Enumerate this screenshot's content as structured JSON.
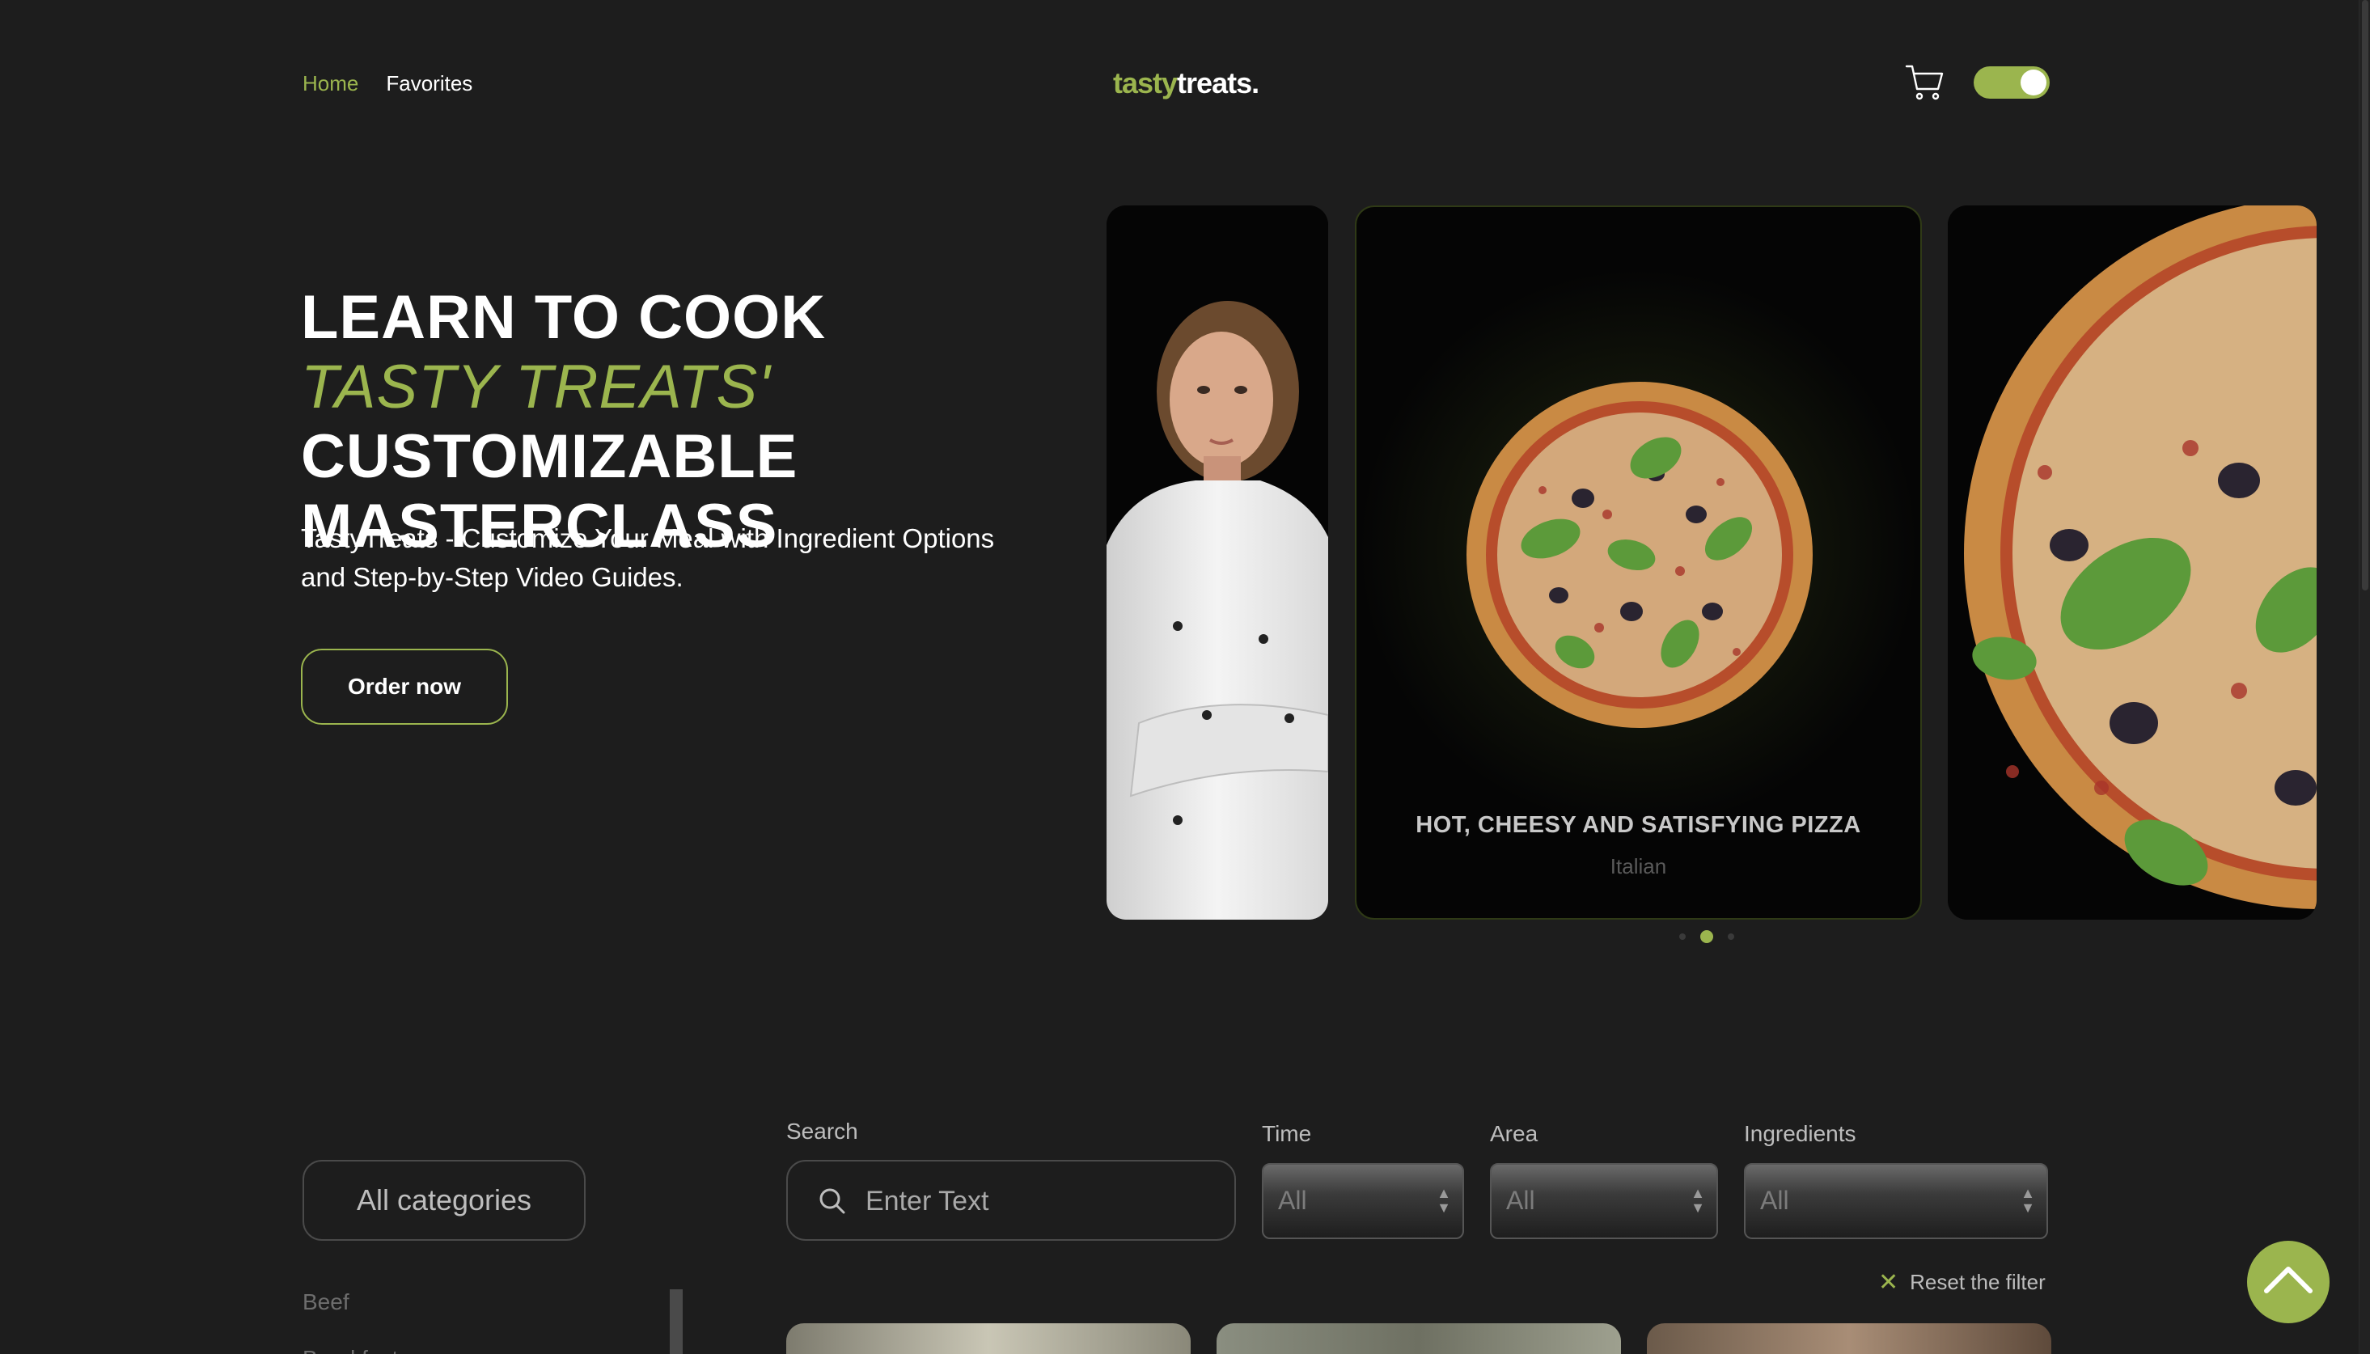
{
  "nav": {
    "home": "Home",
    "favorites": "Favorites"
  },
  "logo": {
    "part1": "tasty",
    "part2": "treats."
  },
  "header": {
    "cart_icon": "cart-icon",
    "theme_toggle": "on"
  },
  "colors": {
    "accent": "#9bb54e",
    "background": "#1d1d1d"
  },
  "hero": {
    "title_part1": "LEARN TO COOK ",
    "title_accent": "TASTY TREATS'",
    "title_part2": " CUSTOMIZABLE MASTERCLASS",
    "subtitle": "TastyTreats - Customize Your Meal with Ingredient Options and Step-by-Step Video Guides.",
    "order_button": "Order now"
  },
  "slider": {
    "center_title": "HOT, CHEESY AND SATISFYING PIZZA",
    "center_subtitle": "Italian",
    "active_dot": 2,
    "dot_count": 3
  },
  "filters": {
    "categories_button": "All categories",
    "categories": [
      "Beef",
      "Breakfast"
    ],
    "search_label": "Search",
    "search_placeholder": "Enter Text",
    "time_label": "Time",
    "time_value": "All",
    "area_label": "Area",
    "area_value": "All",
    "ingredients_label": "Ingredients",
    "ingredients_value": "All",
    "reset_label": "Reset the filter"
  }
}
